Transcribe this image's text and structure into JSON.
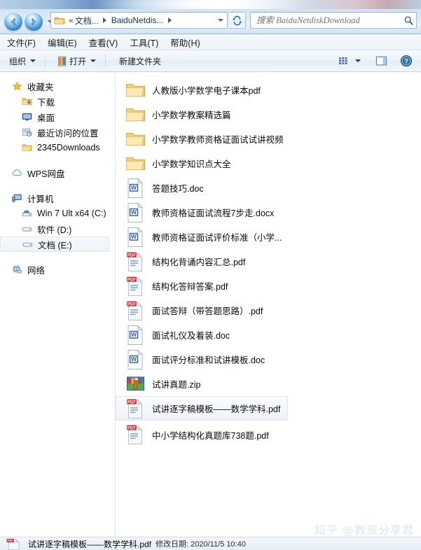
{
  "window": {
    "nav": {
      "back_label": "后退",
      "forward_label": "前进",
      "recent_pages_label": "最近浏览的页面",
      "refresh_label": "刷新"
    },
    "address": {
      "chevrons": "«",
      "crumbs": [
        "文档...",
        "BaiduNetdis..."
      ]
    },
    "search": {
      "placeholder": "搜索 BaiduNetdiskDownload",
      "value": ""
    }
  },
  "menubar": {
    "items": [
      {
        "label": "文件(F)"
      },
      {
        "label": "编辑(E)"
      },
      {
        "label": "查看(V)"
      },
      {
        "label": "工具(T)"
      },
      {
        "label": "帮助(H)"
      }
    ]
  },
  "toolbar": {
    "organize_label": "组织",
    "open_label": "打开",
    "new_folder_label": "新建文件夹",
    "views_label": "更改您的视图",
    "preview_label": "显示预览窗格",
    "help_label": "获取帮助"
  },
  "sidebar": {
    "groups": [
      {
        "name": "favorites",
        "header": {
          "label": "收藏夹",
          "icon": "star-icon"
        },
        "items": [
          {
            "label": "下载",
            "icon": "downloads-icon"
          },
          {
            "label": "桌面",
            "icon": "desktop-icon"
          },
          {
            "label": "最近访问的位置",
            "icon": "recent-places-icon"
          },
          {
            "label": "2345Downloads",
            "icon": "folder-icon"
          }
        ]
      },
      {
        "name": "wps-cloud",
        "header": {
          "label": "WPS网盘",
          "icon": "cloud-icon"
        },
        "items": []
      },
      {
        "name": "computer",
        "header": {
          "label": "计算机",
          "icon": "computer-icon"
        },
        "items": [
          {
            "label": "Win 7 Ult x64 (C:)",
            "icon": "system-drive-icon",
            "selected": false
          },
          {
            "label": "软件 (D:)",
            "icon": "drive-icon",
            "selected": false
          },
          {
            "label": "文档 (E:)",
            "icon": "drive-icon",
            "selected": true
          }
        ]
      },
      {
        "name": "network",
        "header": {
          "label": "网络",
          "icon": "network-icon"
        },
        "items": []
      }
    ]
  },
  "files": [
    {
      "name": "人教版小学数学电子课本pdf",
      "type": "folder",
      "selected": false
    },
    {
      "name": "小学数学教案精选篇",
      "type": "folder",
      "selected": false
    },
    {
      "name": "小学数学教师资格证面试试讲视频",
      "type": "folder",
      "selected": false
    },
    {
      "name": "小学数学知识点大全",
      "type": "folder",
      "selected": false
    },
    {
      "name": "答题技巧.doc",
      "type": "doc",
      "selected": false
    },
    {
      "name": "教师资格证面试流程7步走.docx",
      "type": "doc",
      "selected": false
    },
    {
      "name": "教师资格证面试评价标准（小学...",
      "type": "doc",
      "selected": false
    },
    {
      "name": "结构化背诵内容汇总.pdf",
      "type": "pdf",
      "selected": false
    },
    {
      "name": "结构化答辩答案.pdf",
      "type": "pdf",
      "selected": false
    },
    {
      "name": "面试答辩（带答题思路）.pdf",
      "type": "pdf",
      "selected": false
    },
    {
      "name": "面试礼仪及着装.doc",
      "type": "doc",
      "selected": false
    },
    {
      "name": "面试评分标准和试讲模板.doc",
      "type": "doc",
      "selected": false
    },
    {
      "name": "试讲真题.zip",
      "type": "zip",
      "selected": false
    },
    {
      "name": "试讲逐字稿模板——数学学科.pdf",
      "type": "pdf",
      "selected": true
    },
    {
      "name": "中小学结构化真题库738题.pdf",
      "type": "pdf",
      "selected": false
    }
  ],
  "statusbar": {
    "file_name": "试讲逐字稿模板——数学学科.pdf",
    "meta": "修改日期: 2020/11/5 10:40",
    "icon": "pdf-icon"
  },
  "watermark": {
    "text": "知乎 @教资分享君"
  },
  "colors": {
    "accent": "#2a7fcd",
    "pdf_red": "#cc2127",
    "word_blue": "#2a5db0",
    "folder_yellow": "#fcd77f",
    "selection_bg": "#eef2f7"
  }
}
